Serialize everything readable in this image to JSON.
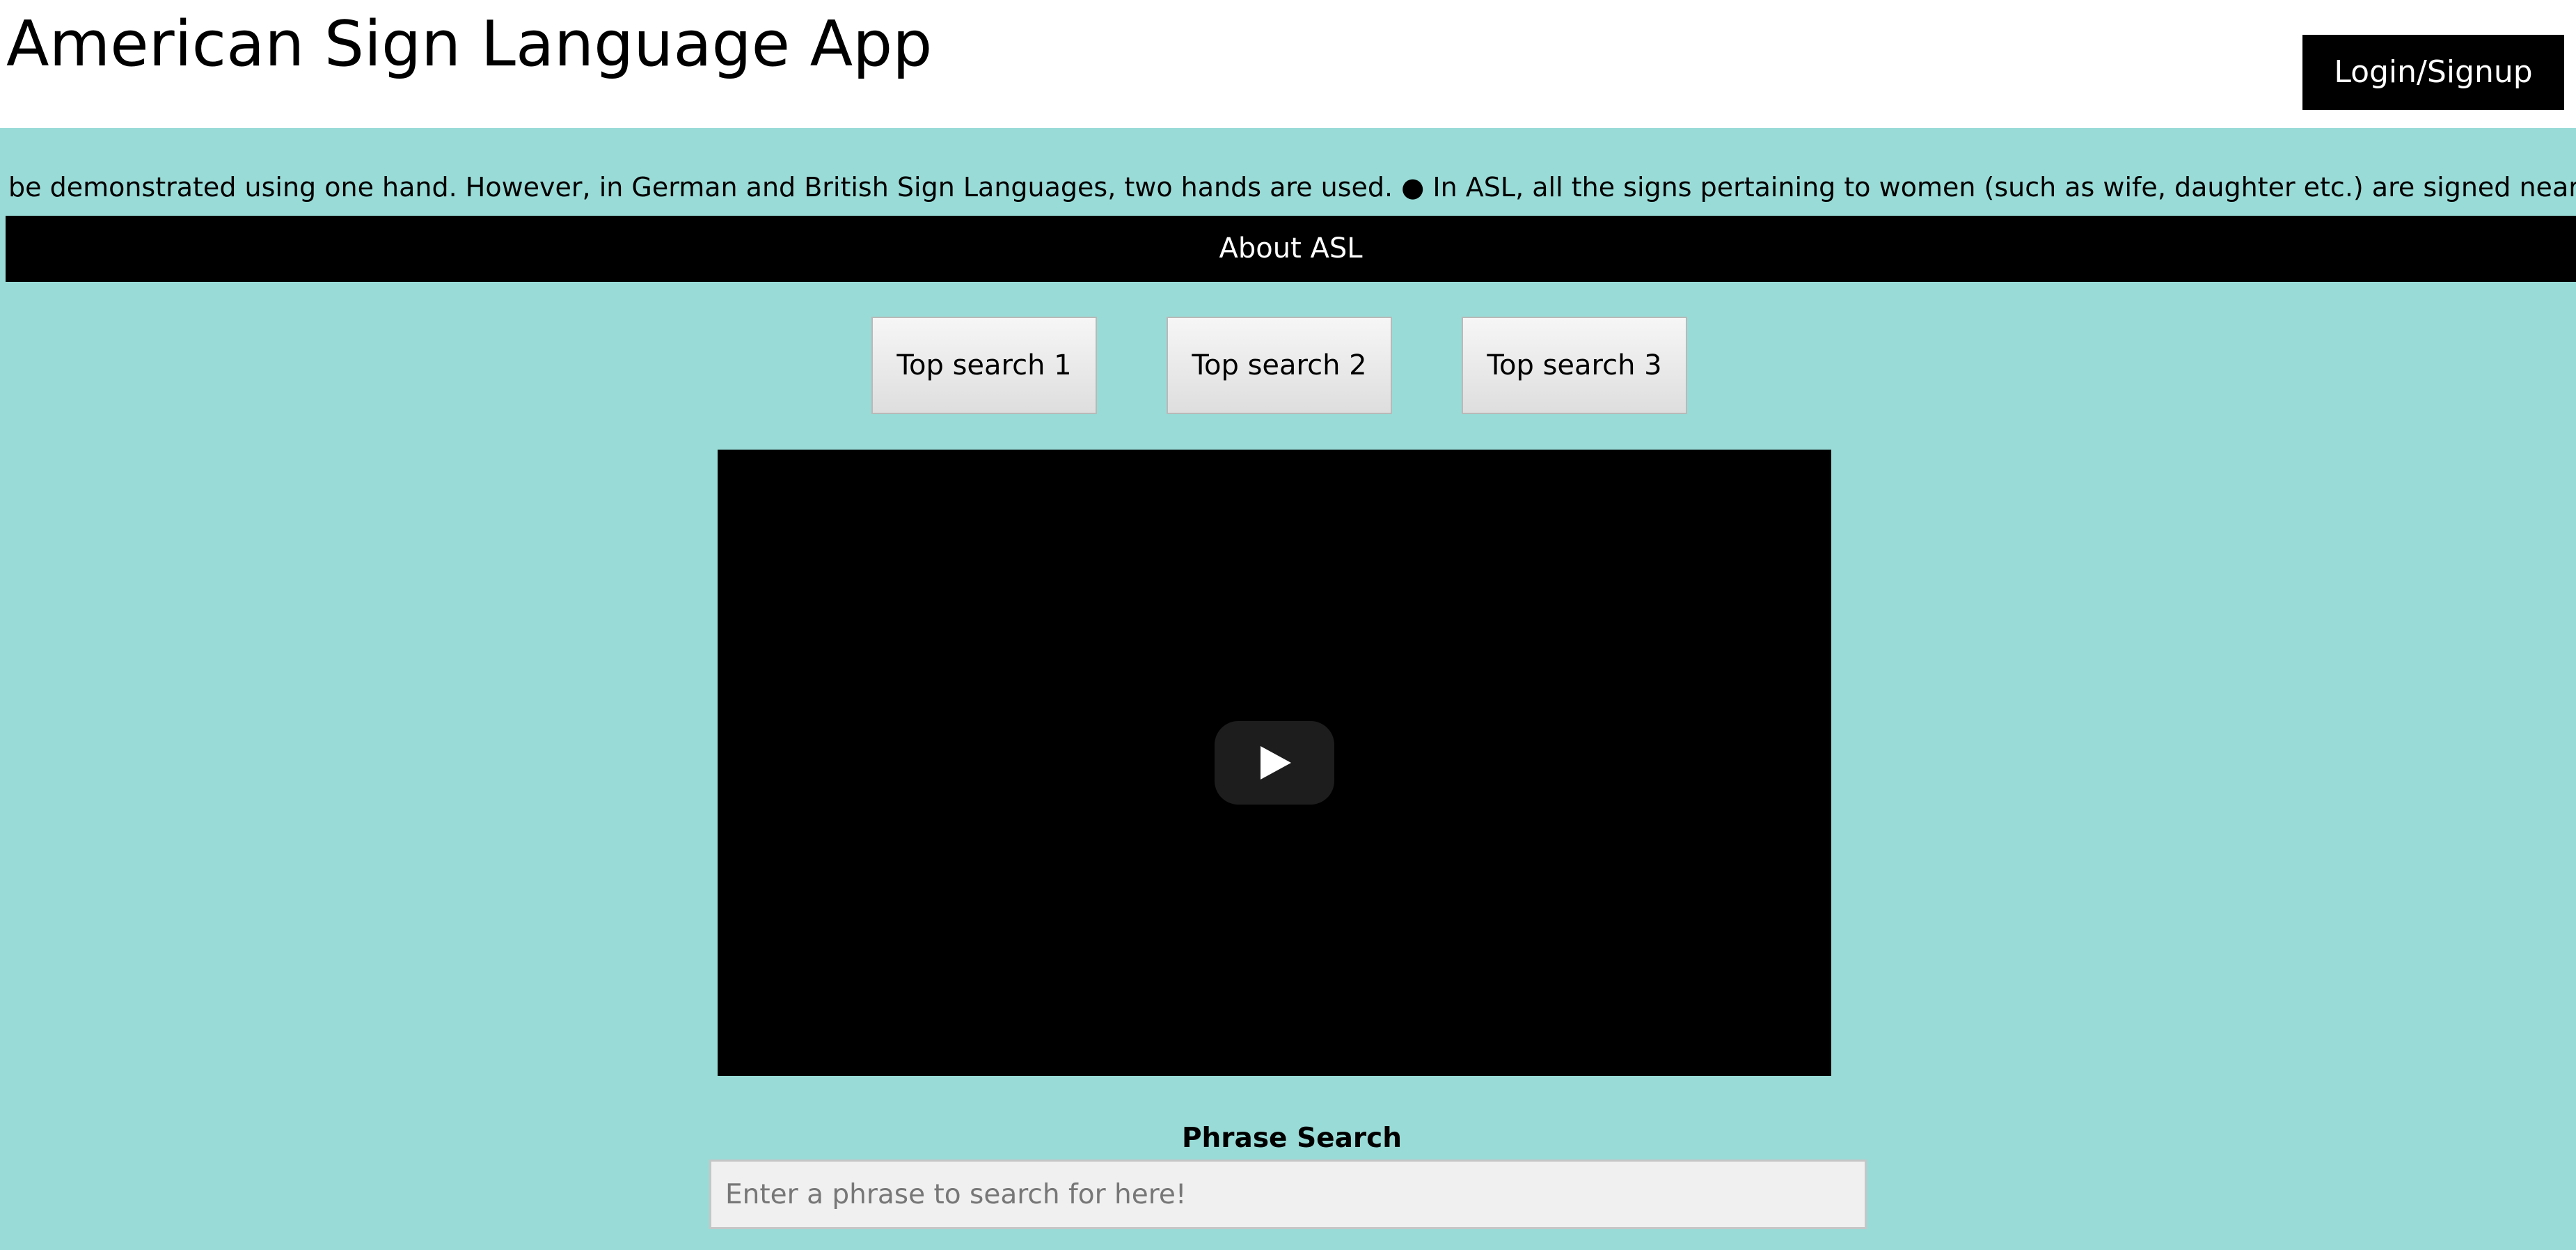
{
  "header": {
    "title": "American Sign Language App",
    "login_label": "Login/Signup"
  },
  "ticker": {
    "text": "be demonstrated using one hand. However, in German and British Sign Languages, two hands are used. ● In ASL, all the signs pertaining to women (such as wife, daughter etc.) are signed near"
  },
  "nav": {
    "about_label": "About ASL"
  },
  "top_searches": [
    {
      "label": "Top search 1"
    },
    {
      "label": "Top search 2"
    },
    {
      "label": "Top search 3"
    }
  ],
  "video": {
    "play_icon": "play-icon"
  },
  "phrase_search": {
    "label": "Phrase Search",
    "value": "",
    "placeholder": "Enter a phrase to search for here!"
  },
  "colors": {
    "background": "#99dbd7",
    "header": "#ffffff",
    "accent": "#000000"
  }
}
